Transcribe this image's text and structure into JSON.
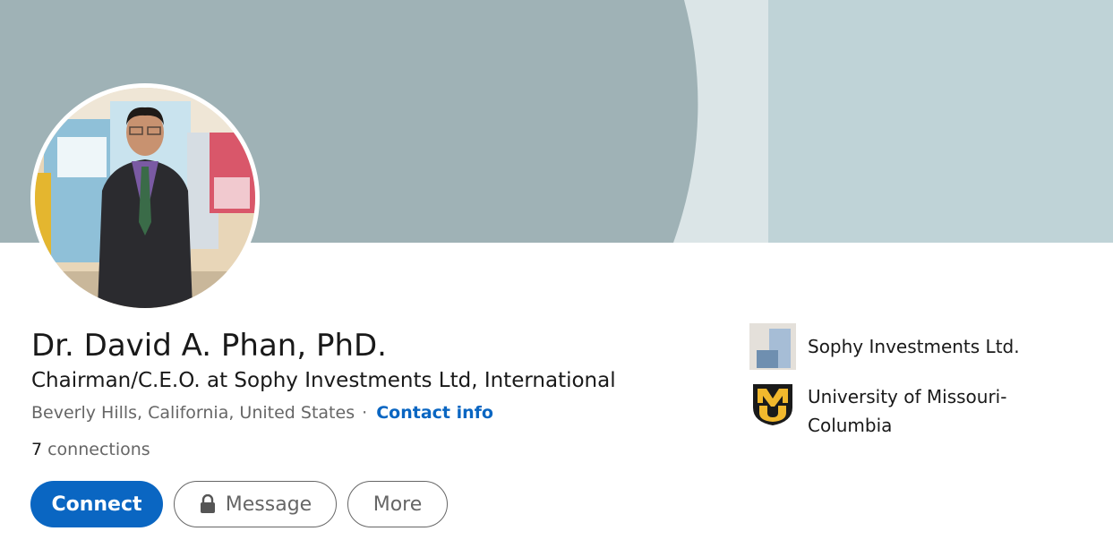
{
  "profile": {
    "name": "Dr. David A. Phan, PhD.",
    "headline": "Chairman/C.E.O. at Sophy Investments Ltd, International",
    "location": "Beverly Hills, California, United States",
    "separator": "·",
    "contact_info_label": "Contact info",
    "connections_count": "7",
    "connections_label": "connections"
  },
  "actions": {
    "connect_label": "Connect",
    "message_label": "Message",
    "more_label": "More"
  },
  "side": {
    "company": "Sophy Investments Ltd.",
    "education": "University of Missouri-Columbia"
  },
  "colors": {
    "banner_left": "#9fb2b6",
    "banner_mid": "#dbe5e7",
    "banner_right": "#bfd3d7",
    "primary": "#0a66c2",
    "muted_text": "#666666"
  }
}
